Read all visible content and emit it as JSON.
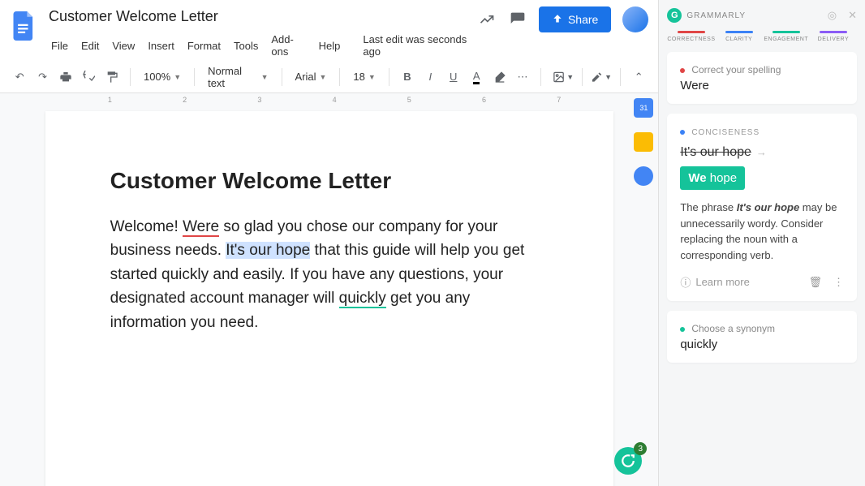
{
  "doc": {
    "title": "Customer Welcome Letter",
    "menus": [
      "File",
      "Edit",
      "View",
      "Insert",
      "Format",
      "Tools",
      "Add-ons",
      "Help"
    ],
    "last_edit": "Last edit was seconds ago",
    "share": "Share",
    "zoom": "100%",
    "style": "Normal text",
    "font": "Arial",
    "font_size": "18",
    "ruler_numbers": [
      "1",
      "2",
      "3",
      "4",
      "5",
      "6",
      "7"
    ]
  },
  "content": {
    "heading": "Customer Welcome Letter",
    "p_before_were": "Welcome! ",
    "were": "Were",
    "p_after_were": " so glad you chose our company for your business needs. ",
    "hope": "It's our hope",
    "p_after_hope": " that this guide will help you get started quickly and easily. If you have any questions, your designated account manager will ",
    "quickly": "quickly",
    "p_after_quickly": " get you any information you need."
  },
  "fab_count": "3",
  "grammarly": {
    "title": "GRAMMARLY",
    "tabs": [
      {
        "label": "CORRECTNESS",
        "color": "#e04646"
      },
      {
        "label": "CLARITY",
        "color": "#3b82f6"
      },
      {
        "label": "ENGAGEMENT",
        "color": "#15c39a"
      },
      {
        "label": "DELIVERY",
        "color": "#8b5cf6"
      }
    ],
    "card1": {
      "hint": "Correct your spelling",
      "word": "Were",
      "dot": "#e04646"
    },
    "card2": {
      "dot": "#3b82f6",
      "category": "CONCISENESS",
      "strike": "It's our hope",
      "suggest_bold": "We",
      "suggest_rest": " hope",
      "explain_pre": "The phrase ",
      "explain_b": "It's our hope",
      "explain_post": " may be unnecessarily wordy. Consider replacing the noun with a corresponding verb.",
      "learn": "Learn more"
    },
    "card3": {
      "hint": "Choose a synonym",
      "word": "quickly",
      "dot": "#15c39a"
    }
  }
}
